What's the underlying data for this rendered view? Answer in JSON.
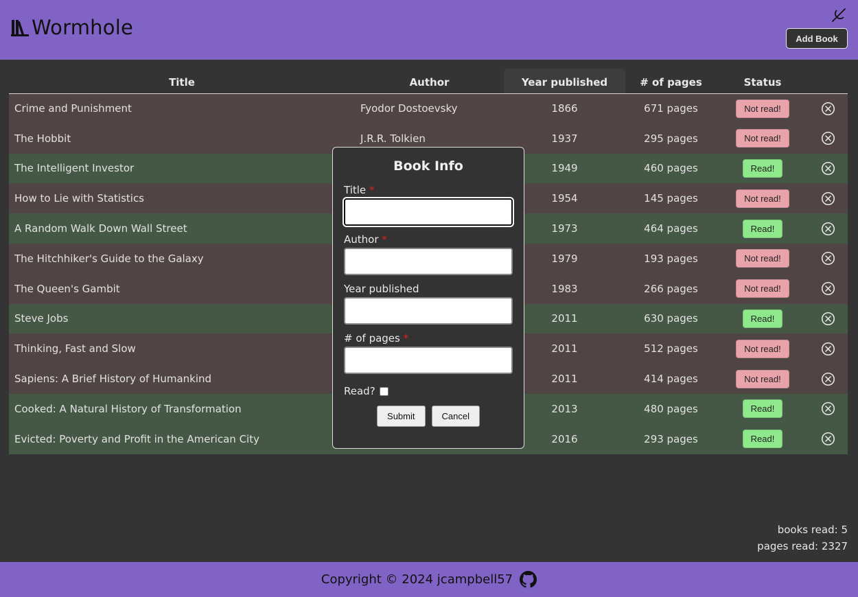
{
  "header": {
    "title": "Wormhole",
    "add_book_label": "Add Book"
  },
  "table": {
    "columns": [
      "Title",
      "Author",
      "Year published",
      "# of pages",
      "Status"
    ],
    "rows": [
      {
        "title": "Crime and Punishment",
        "author": "Fyodor Dostoevsky",
        "year": "1866",
        "pages": "671 pages",
        "status": "Not read!",
        "read": false
      },
      {
        "title": "The Hobbit",
        "author": "J.R.R. Tolkien",
        "year": "1937",
        "pages": "295 pages",
        "status": "Not read!",
        "read": false
      },
      {
        "title": "The Intelligent Investor",
        "author": "",
        "year": "1949",
        "pages": "460 pages",
        "status": "Read!",
        "read": true
      },
      {
        "title": "How to Lie with Statistics",
        "author": "",
        "year": "1954",
        "pages": "145 pages",
        "status": "Not read!",
        "read": false
      },
      {
        "title": "A Random Walk Down Wall Street",
        "author": "",
        "year": "1973",
        "pages": "464 pages",
        "status": "Read!",
        "read": true
      },
      {
        "title": "The Hitchhiker's Guide to the Galaxy",
        "author": "",
        "year": "1979",
        "pages": "193 pages",
        "status": "Not read!",
        "read": false
      },
      {
        "title": "The Queen's Gambit",
        "author": "",
        "year": "1983",
        "pages": "266 pages",
        "status": "Not read!",
        "read": false
      },
      {
        "title": "Steve Jobs",
        "author": "",
        "year": "2011",
        "pages": "630 pages",
        "status": "Read!",
        "read": true
      },
      {
        "title": "Thinking, Fast and Slow",
        "author": "",
        "year": "2011",
        "pages": "512 pages",
        "status": "Not read!",
        "read": false
      },
      {
        "title": "Sapiens: A Brief History of Humankind",
        "author": "",
        "year": "2011",
        "pages": "414 pages",
        "status": "Not read!",
        "read": false
      },
      {
        "title": "Cooked: A Natural History of Transformation",
        "author": "",
        "year": "2013",
        "pages": "480 pages",
        "status": "Read!",
        "read": true
      },
      {
        "title": "Evicted: Poverty and Profit in the American City",
        "author": "",
        "year": "2016",
        "pages": "293 pages",
        "status": "Read!",
        "read": true
      }
    ]
  },
  "modal": {
    "title": "Book Info",
    "title_label": "Title",
    "author_label": "Author",
    "year_label": "Year published",
    "pages_label": "# of pages",
    "required_mark": "*",
    "read_label": "Read?",
    "submit_label": "Submit",
    "cancel_label": "Cancel",
    "title_value": "",
    "author_value": "",
    "year_value": "",
    "pages_value": ""
  },
  "stats": {
    "books_read": "books read: 5",
    "pages_read": "pages read: 2327"
  },
  "footer": {
    "copyright": "Copyright © 2024 jcampbell57"
  },
  "colors": {
    "accent": "#8163c6",
    "background": "#343434",
    "row_unread": "#514444",
    "row_read": "#445845",
    "badge_unread": "#e8a4aa",
    "badge_read": "#8fe88c"
  },
  "icons": {
    "brand": "books-icon",
    "theme_toggle": "theme-toggle-icon",
    "remove": "close-circle-icon",
    "github": "github-icon"
  }
}
